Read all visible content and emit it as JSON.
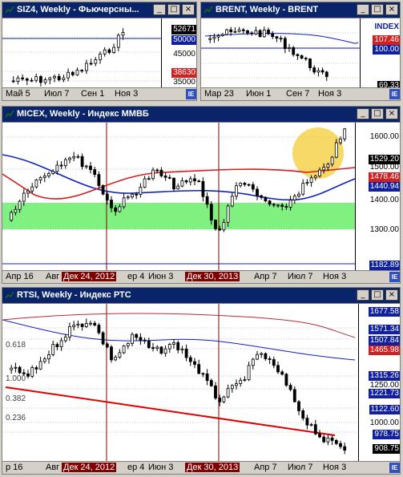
{
  "windows": {
    "siz": {
      "title": "SIZ4, Weekly - Фьючерсны...",
      "buttons": [
        "_",
        "□",
        "×"
      ],
      "price_labels": [
        {
          "text": "52671",
          "bg": "#000000",
          "fg": "#ffffff"
        },
        {
          "text": "50000",
          "bg": "#1020a0",
          "fg": "#ffffff"
        },
        {
          "text": "45000",
          "bg": "#ffffff",
          "fg": "#000000"
        },
        {
          "text": "38630",
          "bg": "#d02020",
          "fg": "#ffffff"
        },
        {
          "text": "35000",
          "bg": "#ffffff",
          "fg": "#000000"
        }
      ],
      "x_ticks": [
        "Май 5",
        "Июл 7",
        "Сен 1",
        "Ноя 3"
      ]
    },
    "brent": {
      "title": "BRENT, Weekly - BRENT",
      "buttons": [
        "_",
        "□",
        "×"
      ],
      "price_labels": [
        {
          "text": "INDEX",
          "bg": "#ffffff",
          "fg": "#1020a0"
        },
        {
          "text": "107.46",
          "bg": "#d02020",
          "fg": "#ffffff"
        },
        {
          "text": "100.00",
          "bg": "#1020a0",
          "fg": "#ffffff"
        },
        {
          "text": "69.33",
          "bg": "#000000",
          "fg": "#ffffff"
        }
      ],
      "x_ticks": [
        "Мар 23",
        "Июн 1",
        "Сен 7",
        "Ноя 3"
      ]
    },
    "micex": {
      "title": "MICEX, Weekly - Индекс ММВБ",
      "buttons": [
        "_",
        "□",
        "×"
      ],
      "price_labels": [
        {
          "text": "1600.00",
          "bg": "#ffffff",
          "fg": "#000000"
        },
        {
          "text": "1529.20",
          "bg": "#000000",
          "fg": "#ffffff"
        },
        {
          "text": "1500.00",
          "bg": "#ffffff",
          "fg": "#000000"
        },
        {
          "text": "1478.46",
          "bg": "#d02020",
          "fg": "#ffffff"
        },
        {
          "text": "1440.94",
          "bg": "#1020a0",
          "fg": "#ffffff"
        },
        {
          "text": "1400.00",
          "bg": "#ffffff",
          "fg": "#000000"
        },
        {
          "text": "1300.00",
          "bg": "#ffffff",
          "fg": "#000000"
        },
        {
          "text": "1182.89",
          "bg": "#1020a0",
          "fg": "#ffffff"
        }
      ],
      "x_ticks": [
        {
          "text": "Апр 16",
          "hl": false
        },
        {
          "text": "Авг",
          "hl": false
        },
        {
          "text": "Дек 24, 2012",
          "hl": true
        },
        {
          "text": "ер 4",
          "hl": false
        },
        {
          "text": "Июн 3",
          "hl": false
        },
        {
          "text": "Дек 30, 2013",
          "hl": true
        },
        {
          "text": "Апр 7",
          "hl": false
        },
        {
          "text": "Июл 7",
          "hl": false
        },
        {
          "text": "Ноя 3",
          "hl": false
        }
      ]
    },
    "rtsi": {
      "title": "RTSI, Weekly - Индекс РТС",
      "buttons": [
        "_",
        "□",
        "×"
      ],
      "price_labels": [
        {
          "text": "1677.58",
          "bg": "#1020a0",
          "fg": "#ffffff"
        },
        {
          "text": "1571.34",
          "bg": "#1020a0",
          "fg": "#ffffff"
        },
        {
          "text": "1507.84",
          "bg": "#1020a0",
          "fg": "#ffffff"
        },
        {
          "text": "1465.98",
          "bg": "#d02020",
          "fg": "#ffffff"
        },
        {
          "text": "1315.26",
          "bg": "#1020a0",
          "fg": "#ffffff"
        },
        {
          "text": "1250.00",
          "bg": "#ffffff",
          "fg": "#000000"
        },
        {
          "text": "1221.73",
          "bg": "#1020a0",
          "fg": "#ffffff"
        },
        {
          "text": "1122.60",
          "bg": "#1020a0",
          "fg": "#ffffff"
        },
        {
          "text": "1000.00",
          "bg": "#ffffff",
          "fg": "#000000"
        },
        {
          "text": "978.75",
          "bg": "#1020a0",
          "fg": "#ffffff"
        },
        {
          "text": "908.75",
          "bg": "#000000",
          "fg": "#ffffff"
        }
      ],
      "fib_labels": [
        "0.618",
        "1.000",
        "0.382",
        "0.236"
      ],
      "x_ticks": [
        {
          "text": "р 16",
          "hl": false
        },
        {
          "text": "Авг",
          "hl": false
        },
        {
          "text": "Дек 24, 2012",
          "hl": true
        },
        {
          "text": "ер 4",
          "hl": false
        },
        {
          "text": "Июн 3",
          "hl": false
        },
        {
          "text": "Дек 30, 2013",
          "hl": true
        },
        {
          "text": "Апр 7",
          "hl": false
        },
        {
          "text": "Июл 7",
          "hl": false
        },
        {
          "text": "Ноя 3",
          "hl": false
        }
      ]
    }
  },
  "colors": {
    "title_bg": "#0a246a",
    "candle": "#000000",
    "ma_red": "#d02020",
    "ma_blue": "#1020c0",
    "green_zone": "#80f080",
    "highlight": "#f0c000",
    "trend": "#e00000"
  }
}
